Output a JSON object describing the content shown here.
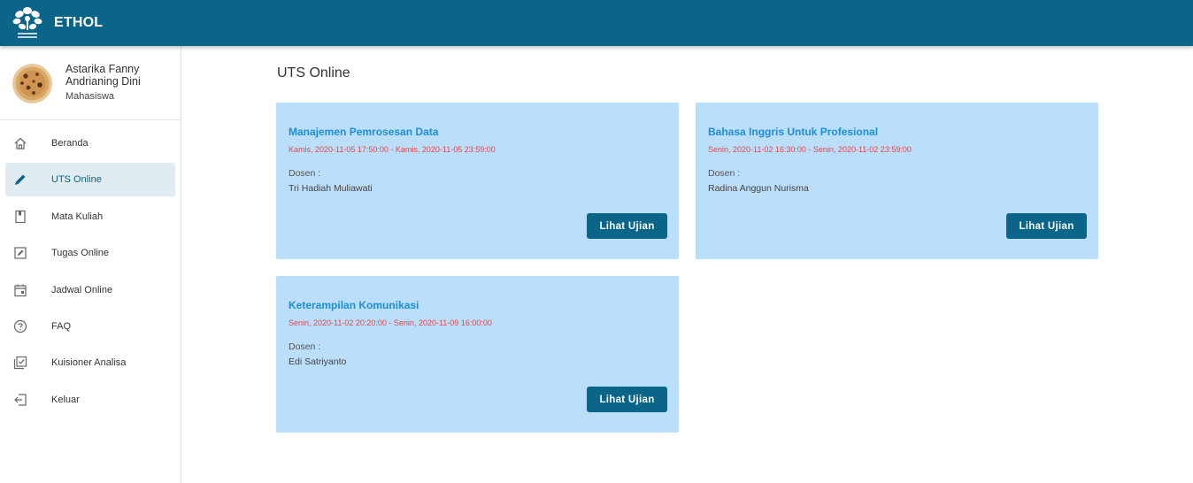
{
  "header": {
    "title": "ETHOL",
    "logo_icon": "pens-logo"
  },
  "user": {
    "name": "Astarika Fanny Andrianing Dini",
    "role": "Mahasiswa"
  },
  "sidebar": {
    "items": [
      {
        "label": "Beranda",
        "icon": "home-icon"
      },
      {
        "label": "UTS Online",
        "icon": "pencil-icon",
        "active": true
      },
      {
        "label": "Mata Kuliah",
        "icon": "book-icon"
      },
      {
        "label": "Tugas Online",
        "icon": "edit-square-icon"
      },
      {
        "label": "Jadwal Online",
        "icon": "calendar-icon"
      },
      {
        "label": "FAQ",
        "icon": "help-circle-icon"
      },
      {
        "label": "Kuisioner Analisa",
        "icon": "checklist-icon"
      },
      {
        "label": "Keluar",
        "icon": "logout-icon"
      }
    ]
  },
  "main": {
    "title": "UTS Online",
    "cards": [
      {
        "course": "Manajemen Pemrosesan Data",
        "time": "Kamis, 2020-11-05 17:50:00 - Kamis, 2020-11-05 23:59:00",
        "dosen_label": "Dosen :",
        "dosen": "Tri Hadiah Muliawati",
        "button": "Lihat Ujian"
      },
      {
        "course": "Bahasa Inggris Untuk Profesional",
        "time": "Senin, 2020-11-02 16:30:00 - Senin, 2020-11-02 23:59:00",
        "dosen_label": "Dosen :",
        "dosen": "Radina Anggun Nurisma",
        "button": "Lihat Ujian"
      },
      {
        "course": "Keterampilan Komunikasi",
        "time": "Senin, 2020-11-02 20:20:00 - Senin, 2020-11-09 16:00:00",
        "dosen_label": "Dosen :",
        "dosen": "Edi Satriyanto",
        "button": "Lihat Ujian"
      }
    ]
  },
  "colors": {
    "primary": "#0b6589",
    "card_bg": "#bbdefa",
    "course_title": "#1d8ed8",
    "time_text": "#e8464a"
  }
}
